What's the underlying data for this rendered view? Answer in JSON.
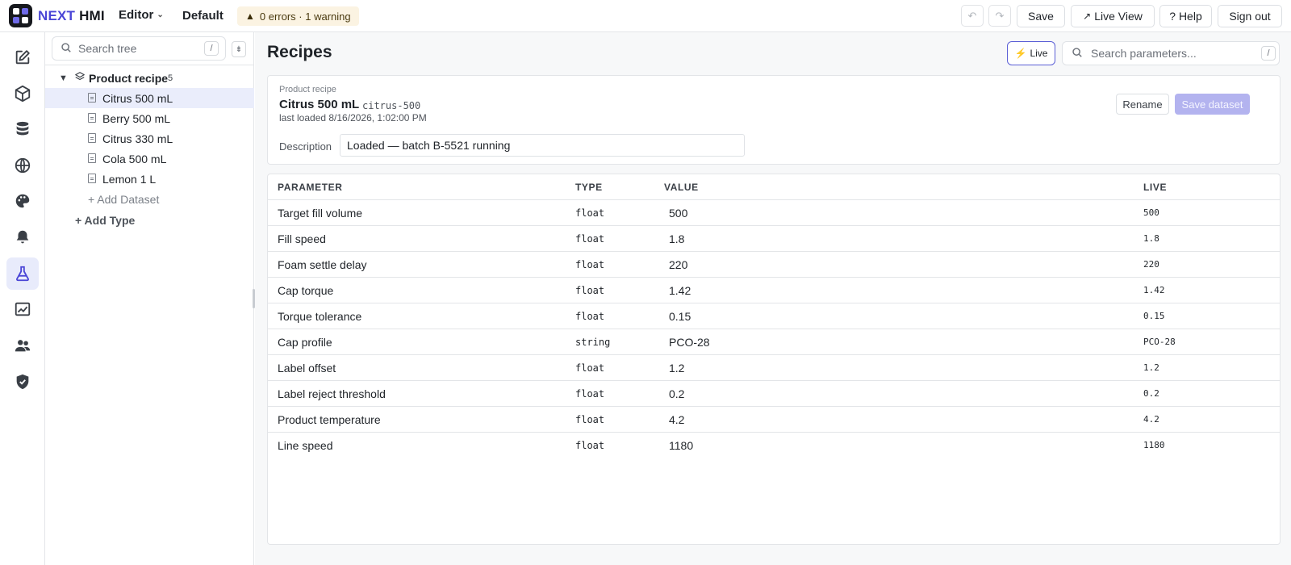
{
  "app": {
    "brand_part1": "NEXT",
    "brand_part2": "HMI",
    "editor_menu": "Editor",
    "profile": "Default",
    "status": "0 errors · 1 warning",
    "accent": "#4a45d6"
  },
  "toolbar": {
    "save": "Save",
    "live_view": "Live View",
    "help": "? Help",
    "sign_out": "Sign out"
  },
  "rail": {
    "items": [
      {
        "name": "edit",
        "icon": "edit-icon"
      },
      {
        "name": "objects",
        "icon": "cube-icon"
      },
      {
        "name": "data",
        "icon": "database-icon"
      },
      {
        "name": "network",
        "icon": "globe-icon"
      },
      {
        "name": "theme",
        "icon": "palette-icon"
      },
      {
        "name": "alarms",
        "icon": "bell-icon"
      },
      {
        "name": "recipes",
        "icon": "flask-icon",
        "active": true
      },
      {
        "name": "trends",
        "icon": "chart-icon"
      },
      {
        "name": "users",
        "icon": "users-icon"
      },
      {
        "name": "security",
        "icon": "shield-icon"
      }
    ]
  },
  "tree": {
    "search_placeholder": "Search tree",
    "search_shortcut": "/",
    "collapse_glyph": "⇟",
    "group": {
      "label": "Product recipe",
      "count": "5"
    },
    "items": [
      {
        "label": "Citrus 500 mL",
        "selected": true
      },
      {
        "label": "Berry 500 mL"
      },
      {
        "label": "Citrus 330 mL"
      },
      {
        "label": "Cola 500 mL"
      },
      {
        "label": "Lemon 1 L"
      }
    ],
    "add_dataset": "+ Add Dataset",
    "add_type": "+ Add Type"
  },
  "main": {
    "title": "Recipes",
    "live_label": "Live",
    "search_placeholder": "Search parameters...",
    "search_shortcut": "/"
  },
  "dataset": {
    "eyebrow": "Product recipe",
    "name": "Citrus 500 mL",
    "key": "citrus-500",
    "loaded": "last loaded 8/16/2026, 1:02:00 PM",
    "rename": "Rename",
    "save": "Save dataset",
    "description_label": "Description",
    "description_value": "Loaded — batch B-5521 running"
  },
  "table": {
    "headers": {
      "parameter": "PARAMETER",
      "type": "TYPE",
      "value": "VALUE",
      "live": "LIVE"
    },
    "rows": [
      {
        "name": "Target fill volume",
        "type": "float",
        "value": "500",
        "live": "500"
      },
      {
        "name": "Fill speed",
        "type": "float",
        "value": "1.8",
        "live": "1.8"
      },
      {
        "name": "Foam settle delay",
        "type": "float",
        "value": "220",
        "live": "220"
      },
      {
        "name": "Cap torque",
        "type": "float",
        "value": "1.42",
        "live": "1.42"
      },
      {
        "name": "Torque tolerance",
        "type": "float",
        "value": "0.15",
        "live": "0.15"
      },
      {
        "name": "Cap profile",
        "type": "string",
        "value": "PCO-28",
        "live": "PCO-28"
      },
      {
        "name": "Label offset",
        "type": "float",
        "value": "1.2",
        "live": "1.2"
      },
      {
        "name": "Label reject threshold",
        "type": "float",
        "value": "0.2",
        "live": "0.2"
      },
      {
        "name": "Product temperature",
        "type": "float",
        "value": "4.2",
        "live": "4.2"
      },
      {
        "name": "Line speed",
        "type": "float",
        "value": "1180",
        "live": "1180"
      }
    ]
  }
}
